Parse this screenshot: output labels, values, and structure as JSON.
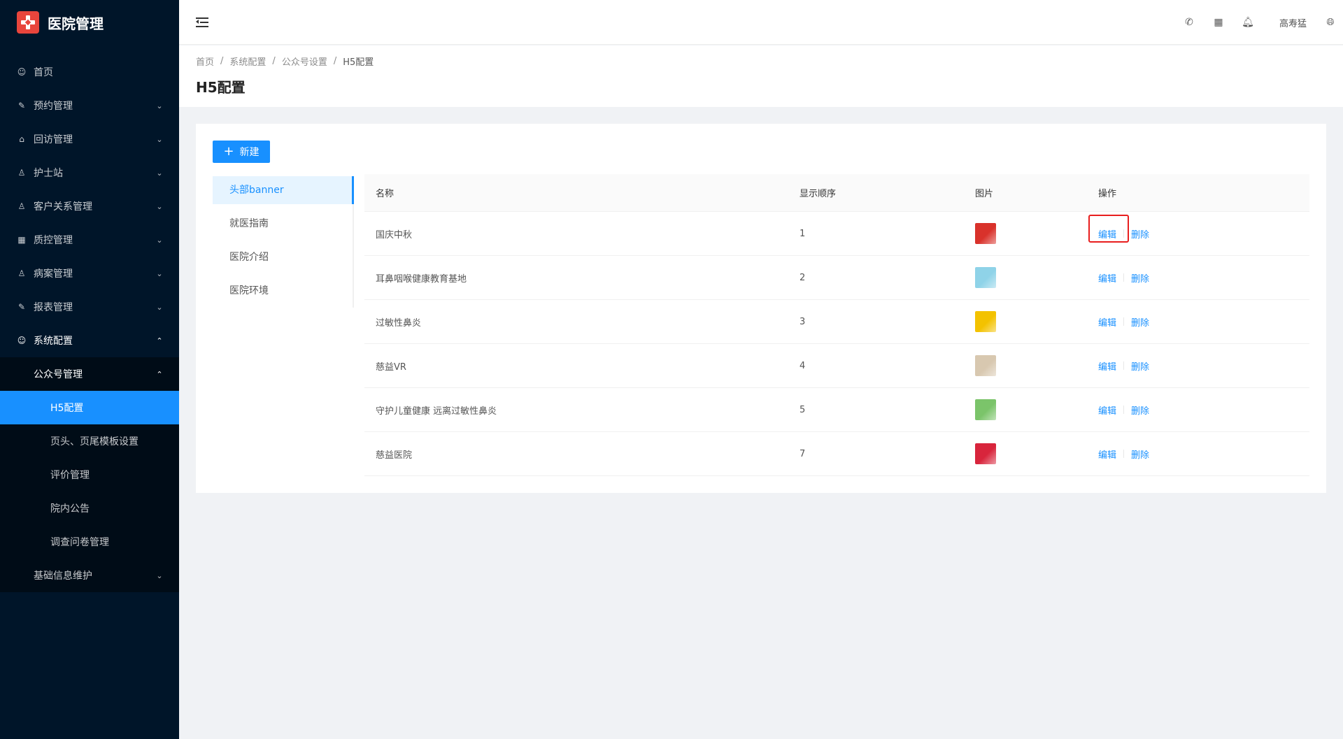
{
  "app": {
    "title": "医院管理"
  },
  "sidebar": {
    "items": [
      {
        "label": "首页",
        "icon": "dashboard-icon"
      },
      {
        "label": "预约管理",
        "icon": "edit-icon"
      },
      {
        "label": "回访管理",
        "icon": "lock-icon"
      },
      {
        "label": "护士站",
        "icon": "user-icon"
      },
      {
        "label": "客户关系管理",
        "icon": "user-icon"
      },
      {
        "label": "质控管理",
        "icon": "table-icon"
      },
      {
        "label": "病案管理",
        "icon": "user-icon"
      },
      {
        "label": "报表管理",
        "icon": "edit-icon"
      },
      {
        "label": "系统配置",
        "icon": "dashboard-icon"
      }
    ],
    "sub": {
      "group_label": "公众号管理",
      "items": [
        {
          "label": "H5配置",
          "active": true
        },
        {
          "label": "页头、页尾模板设置"
        },
        {
          "label": "评价管理"
        },
        {
          "label": "院内公告"
        },
        {
          "label": "调查问卷管理"
        }
      ],
      "after_label": "基础信息维护"
    }
  },
  "header": {
    "icons": [
      "phone-icon",
      "apps-icon",
      "bell-icon"
    ],
    "username": "高寿猛",
    "lang_icon": "globe-icon"
  },
  "breadcrumb": [
    "首页",
    "系统配置",
    "公众号设置",
    "H5配置"
  ],
  "page_title": "H5配置",
  "new_button": "新建",
  "tabs": [
    {
      "label": "头部banner",
      "active": true
    },
    {
      "label": "就医指南"
    },
    {
      "label": "医院介绍"
    },
    {
      "label": "医院环境"
    }
  ],
  "table": {
    "columns": [
      "名称",
      "显示顺序",
      "图片",
      "操作"
    ],
    "rows": [
      {
        "name": "国庆中秋",
        "order": "1",
        "thumb_color": "#d9322b"
      },
      {
        "name": "耳鼻咽喉健康教育基地",
        "order": "2",
        "thumb_color": "#8fd3e8"
      },
      {
        "name": "过敏性鼻炎",
        "order": "3",
        "thumb_color": "#f3c200"
      },
      {
        "name": "慈益VR",
        "order": "4",
        "thumb_color": "#d8c8b0"
      },
      {
        "name": "守护儿童健康 远离过敏性鼻炎",
        "order": "5",
        "thumb_color": "#7bc46a"
      },
      {
        "name": "慈益医院",
        "order": "7",
        "thumb_color": "#d8253c"
      }
    ],
    "edit_label": "编辑",
    "delete_label": "删除"
  },
  "colors": {
    "primary": "#1890ff",
    "sidebar_bg": "#001529",
    "highlight": "#e81e1e"
  }
}
